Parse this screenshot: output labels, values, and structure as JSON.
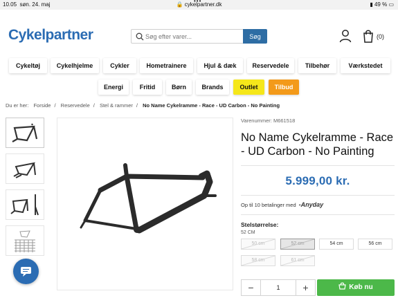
{
  "status_bar": {
    "time": "10.05",
    "date": "søn. 24. maj",
    "url": "cykelpartner.dk",
    "battery": "49 %"
  },
  "header": {
    "logo": "Cykelpartner",
    "search_placeholder": "Søg efter varer...",
    "search_button": "Søg",
    "cart_count": "(0)"
  },
  "nav": {
    "row1": [
      "Cykeltøj",
      "Cykelhjelme",
      "Cykler",
      "Hometrainere",
      "Hjul & dæk",
      "Reservedele",
      "Tilbehør",
      "Værkstedet"
    ],
    "row2": [
      "Energi",
      "Fritid",
      "Børn",
      "Brands",
      "Outlet",
      "Tilbud"
    ]
  },
  "breadcrumb": {
    "prefix": "Du er her:",
    "items": [
      "Forside",
      "Reservedele",
      "Stel & rammer"
    ],
    "current": "No Name Cykelramme - Race - UD Carbon - No Painting"
  },
  "product": {
    "varenummer": "Varenummer: M661518",
    "title": "No Name Cykelramme - Race - UD Carbon - No Painting",
    "price": "5.999,00 kr.",
    "installment_text": "Op til 10 betalinger med",
    "installment_brand": "-Anyday",
    "size_label": "Stelstørrelse:",
    "size_selected": "52 CM",
    "sizes": [
      "50 cm",
      "52 cm",
      "54 cm",
      "56 cm",
      "58 cm",
      "61 cm"
    ],
    "quantity": "1",
    "buy_label": "Køb nu"
  },
  "colors": {
    "brand_blue": "#2b6cb3",
    "buy_green": "#4cb849",
    "outlet_yellow": "#f5e71a",
    "tilbud_orange": "#f39a1a"
  }
}
